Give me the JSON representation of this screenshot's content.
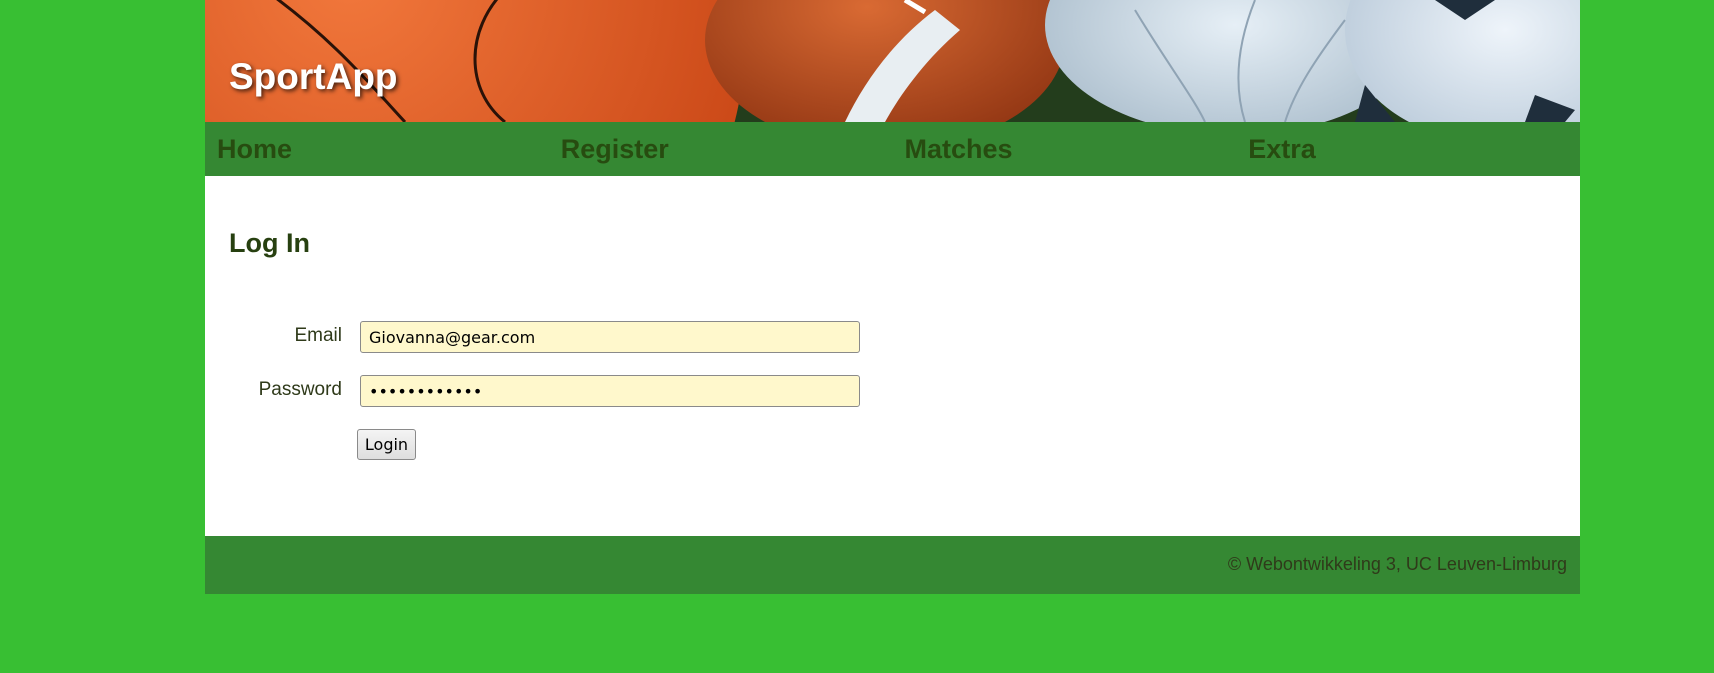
{
  "header": {
    "app_title": "SportApp"
  },
  "nav": {
    "items": [
      {
        "label": "Home"
      },
      {
        "label": "Register"
      },
      {
        "label": "Matches"
      },
      {
        "label": "Extra"
      }
    ]
  },
  "login_form": {
    "heading": "Log In",
    "email_label": "Email",
    "email_value": "Giovanna@gear.com",
    "password_label": "Password",
    "password_value": "••••••••••••",
    "submit_label": "Login"
  },
  "footer": {
    "text": "© Webontwikkeling 3, UC Leuven-Limburg"
  },
  "colors": {
    "page_background": "#38bf33",
    "nav_background": "#358833",
    "nav_text": "#274c10",
    "input_background": "#fff8cc"
  }
}
